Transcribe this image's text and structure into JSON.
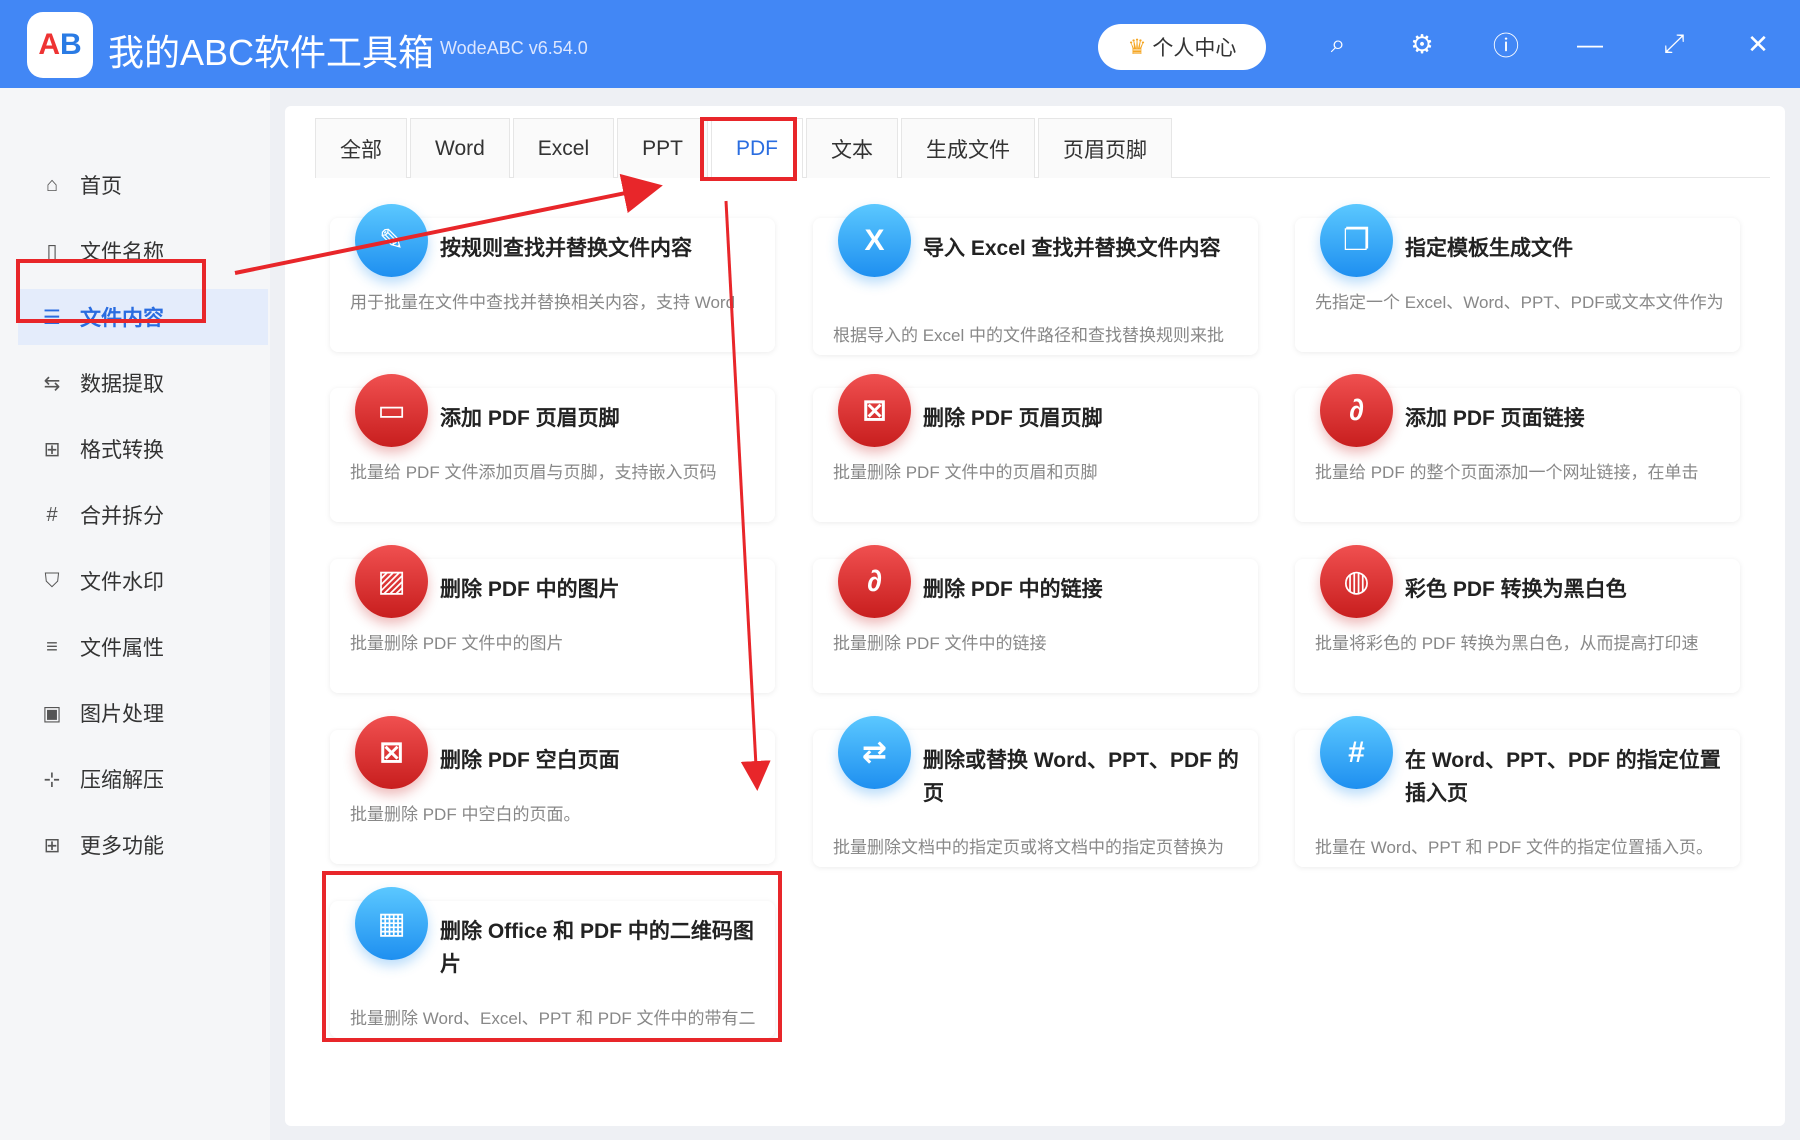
{
  "app": {
    "logo": "AB",
    "title": "我的ABC软件工具箱",
    "version": "WodeABC v6.54.0",
    "user_button": "个人中心"
  },
  "titlebar_icons": [
    "search-icon",
    "gear-icon",
    "help-icon",
    "minimize-icon",
    "maximize-icon",
    "close-icon"
  ],
  "sidebar": {
    "items": [
      {
        "label": "首页",
        "icon": "home-icon"
      },
      {
        "label": "文件名称",
        "icon": "file-icon"
      },
      {
        "label": "文件内容",
        "icon": "list-icon",
        "active": true
      },
      {
        "label": "数据提取",
        "icon": "extract-icon"
      },
      {
        "label": "格式转换",
        "icon": "convert-icon"
      },
      {
        "label": "合并拆分",
        "icon": "hash-icon"
      },
      {
        "label": "文件水印",
        "icon": "shield-icon"
      },
      {
        "label": "文件属性",
        "icon": "properties-icon"
      },
      {
        "label": "图片处理",
        "icon": "image-icon"
      },
      {
        "label": "压缩解压",
        "icon": "compress-icon"
      },
      {
        "label": "更多功能",
        "icon": "grid-icon"
      }
    ]
  },
  "tabs": [
    "全部",
    "Word",
    "Excel",
    "PPT",
    "PDF",
    "文本",
    "生成文件",
    "页眉页脚"
  ],
  "active_tab": "PDF",
  "cards": [
    {
      "title": "按规则查找并替换文件内容",
      "desc": "用于批量在文件中查找并替换相关内容，支持 Word",
      "color": "blue",
      "glyph": "✎"
    },
    {
      "title": "导入 Excel 查找并替换文件内容",
      "desc": "根据导入的 Excel 中的文件路径和查找替换规则来批",
      "color": "blue",
      "glyph": "X"
    },
    {
      "title": "指定模板生成文件",
      "desc": "先指定一个 Excel、Word、PPT、PDF或文本文件作为",
      "color": "blue",
      "glyph": "❐"
    },
    {
      "title": "添加 PDF 页眉页脚",
      "desc": "批量给 PDF 文件添加页眉与页脚，支持嵌入页码",
      "color": "red",
      "glyph": "▭"
    },
    {
      "title": "删除 PDF 页眉页脚",
      "desc": "批量删除 PDF 文件中的页眉和页脚",
      "color": "red",
      "glyph": "⊠"
    },
    {
      "title": "添加 PDF 页面链接",
      "desc": "批量给 PDF 的整个页面添加一个网址链接，在单击",
      "color": "red",
      "glyph": "∂"
    },
    {
      "title": "删除 PDF 中的图片",
      "desc": "批量删除 PDF 文件中的图片",
      "color": "red",
      "glyph": "▨"
    },
    {
      "title": "删除 PDF 中的链接",
      "desc": "批量删除 PDF 文件中的链接",
      "color": "red",
      "glyph": "∂"
    },
    {
      "title": "彩色 PDF 转换为黑白色",
      "desc": "批量将彩色的 PDF 转换为黑白色，从而提高打印速",
      "color": "red",
      "glyph": "◍"
    },
    {
      "title": "删除 PDF 空白页面",
      "desc": "批量删除 PDF 中空白的页面。",
      "color": "red",
      "glyph": "⊠"
    },
    {
      "title": "删除或替换 Word、PPT、PDF 的页",
      "desc": "批量删除文档中的指定页或将文档中的指定页替换为",
      "color": "blue",
      "glyph": "⇄"
    },
    {
      "title": "在 Word、PPT、PDF 的指定位置插入页",
      "desc": "批量在 Word、PPT 和 PDF 文件的指定位置插入页。",
      "color": "blue",
      "glyph": "#"
    },
    {
      "title": "删除 Office 和 PDF 中的二维码图片",
      "desc": "批量删除 Word、Excel、PPT 和 PDF 文件中的带有二",
      "color": "blue",
      "glyph": "▦"
    }
  ],
  "colors": {
    "titlebar": "#4287f5",
    "accent": "#2a6de0",
    "annotation": "#e8262a"
  }
}
